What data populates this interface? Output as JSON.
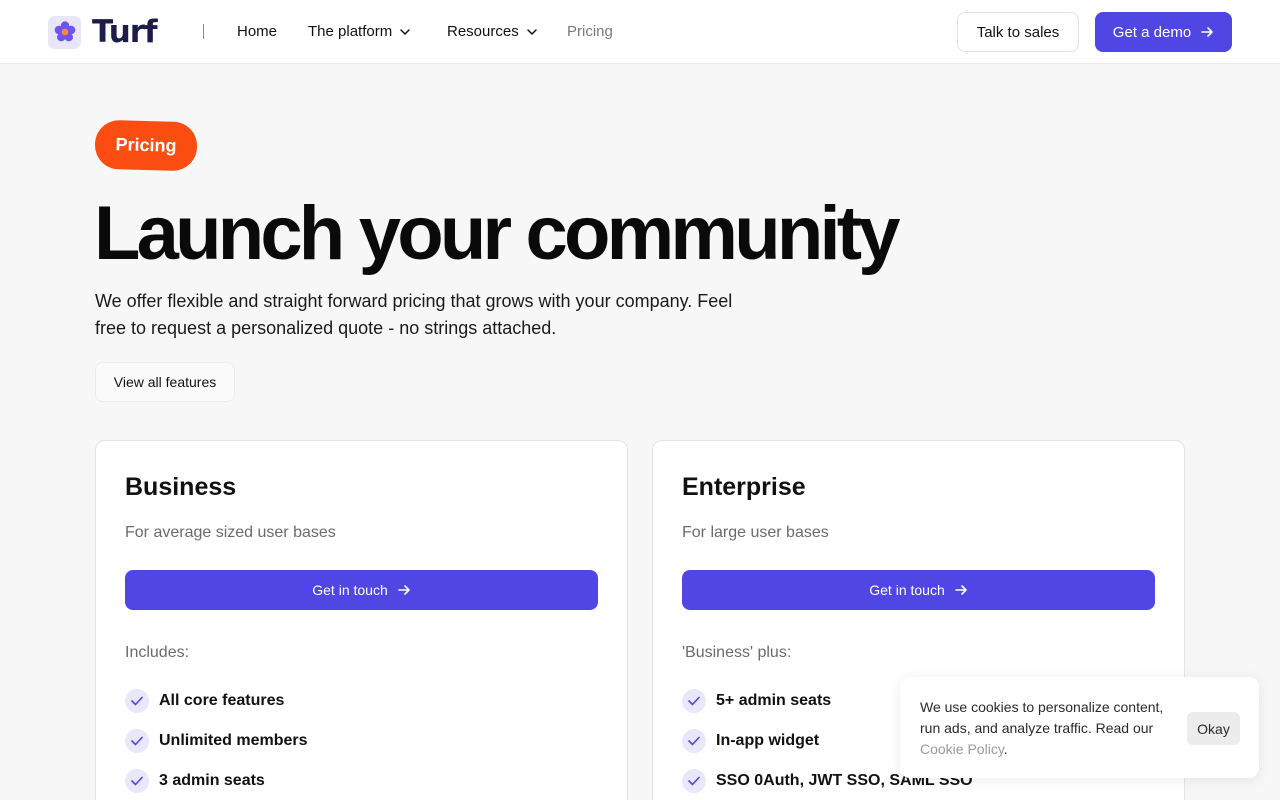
{
  "nav": {
    "brand": "Turf",
    "links": [
      {
        "label": "Home"
      },
      {
        "label": "The platform"
      },
      {
        "label": "Resources"
      },
      {
        "label": "Pricing"
      }
    ],
    "talk_to_sales": "Talk to sales",
    "get_demo": "Get a demo"
  },
  "hero": {
    "badge": "Pricing",
    "title": "Launch your community",
    "subtitle": "We offer flexible and straight forward pricing that grows with your company. Feel free to request a personalized quote - no strings attached.",
    "features_button": "View all features"
  },
  "plans": [
    {
      "name": "Business",
      "description": "For average sized user bases",
      "cta": "Get in touch",
      "includes_label": "Includes:",
      "features": [
        "All core features",
        "Unlimited members",
        "3 admin seats"
      ]
    },
    {
      "name": "Enterprise",
      "description": "For large user bases",
      "cta": "Get in touch",
      "includes_label": "'Business' plus:",
      "features": [
        "5+ admin seats",
        "In-app widget",
        "SSO 0Auth, JWT SSO, SAML SSO"
      ]
    }
  ],
  "cookie": {
    "text": "We use cookies to personalize content, run ads, and analyze traffic. Read our ",
    "link": "Cookie Policy",
    "suffix": ".",
    "button": "Okay"
  },
  "colors": {
    "accent": "#5046e4",
    "badge": "#fb4d12",
    "brand_text": "#1b1c49",
    "background": "#f7f7f7"
  },
  "icons": {
    "logo": "flower-logo-icon",
    "dropdown": "chevron-down-icon",
    "arrow": "arrow-right-icon",
    "check": "check-icon"
  }
}
